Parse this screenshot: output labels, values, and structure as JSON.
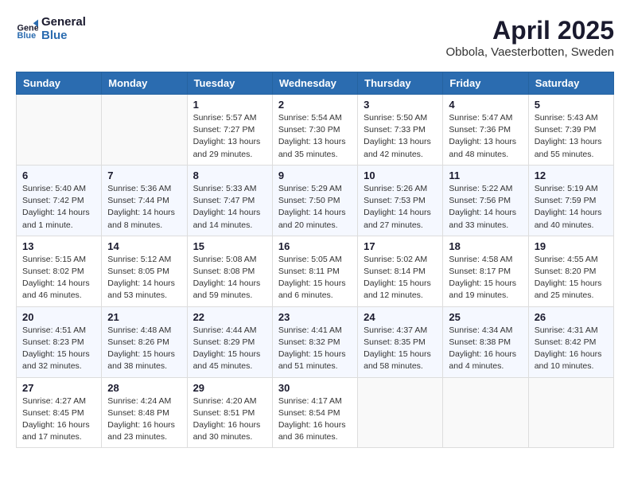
{
  "header": {
    "logo_line1": "General",
    "logo_line2": "Blue",
    "title": "April 2025",
    "subtitle": "Obbola, Vaesterbotten, Sweden"
  },
  "weekdays": [
    "Sunday",
    "Monday",
    "Tuesday",
    "Wednesday",
    "Thursday",
    "Friday",
    "Saturday"
  ],
  "weeks": [
    [
      {
        "day": "",
        "info": ""
      },
      {
        "day": "",
        "info": ""
      },
      {
        "day": "1",
        "info": "Sunrise: 5:57 AM\nSunset: 7:27 PM\nDaylight: 13 hours and 29 minutes."
      },
      {
        "day": "2",
        "info": "Sunrise: 5:54 AM\nSunset: 7:30 PM\nDaylight: 13 hours and 35 minutes."
      },
      {
        "day": "3",
        "info": "Sunrise: 5:50 AM\nSunset: 7:33 PM\nDaylight: 13 hours and 42 minutes."
      },
      {
        "day": "4",
        "info": "Sunrise: 5:47 AM\nSunset: 7:36 PM\nDaylight: 13 hours and 48 minutes."
      },
      {
        "day": "5",
        "info": "Sunrise: 5:43 AM\nSunset: 7:39 PM\nDaylight: 13 hours and 55 minutes."
      }
    ],
    [
      {
        "day": "6",
        "info": "Sunrise: 5:40 AM\nSunset: 7:42 PM\nDaylight: 14 hours and 1 minute."
      },
      {
        "day": "7",
        "info": "Sunrise: 5:36 AM\nSunset: 7:44 PM\nDaylight: 14 hours and 8 minutes."
      },
      {
        "day": "8",
        "info": "Sunrise: 5:33 AM\nSunset: 7:47 PM\nDaylight: 14 hours and 14 minutes."
      },
      {
        "day": "9",
        "info": "Sunrise: 5:29 AM\nSunset: 7:50 PM\nDaylight: 14 hours and 20 minutes."
      },
      {
        "day": "10",
        "info": "Sunrise: 5:26 AM\nSunset: 7:53 PM\nDaylight: 14 hours and 27 minutes."
      },
      {
        "day": "11",
        "info": "Sunrise: 5:22 AM\nSunset: 7:56 PM\nDaylight: 14 hours and 33 minutes."
      },
      {
        "day": "12",
        "info": "Sunrise: 5:19 AM\nSunset: 7:59 PM\nDaylight: 14 hours and 40 minutes."
      }
    ],
    [
      {
        "day": "13",
        "info": "Sunrise: 5:15 AM\nSunset: 8:02 PM\nDaylight: 14 hours and 46 minutes."
      },
      {
        "day": "14",
        "info": "Sunrise: 5:12 AM\nSunset: 8:05 PM\nDaylight: 14 hours and 53 minutes."
      },
      {
        "day": "15",
        "info": "Sunrise: 5:08 AM\nSunset: 8:08 PM\nDaylight: 14 hours and 59 minutes."
      },
      {
        "day": "16",
        "info": "Sunrise: 5:05 AM\nSunset: 8:11 PM\nDaylight: 15 hours and 6 minutes."
      },
      {
        "day": "17",
        "info": "Sunrise: 5:02 AM\nSunset: 8:14 PM\nDaylight: 15 hours and 12 minutes."
      },
      {
        "day": "18",
        "info": "Sunrise: 4:58 AM\nSunset: 8:17 PM\nDaylight: 15 hours and 19 minutes."
      },
      {
        "day": "19",
        "info": "Sunrise: 4:55 AM\nSunset: 8:20 PM\nDaylight: 15 hours and 25 minutes."
      }
    ],
    [
      {
        "day": "20",
        "info": "Sunrise: 4:51 AM\nSunset: 8:23 PM\nDaylight: 15 hours and 32 minutes."
      },
      {
        "day": "21",
        "info": "Sunrise: 4:48 AM\nSunset: 8:26 PM\nDaylight: 15 hours and 38 minutes."
      },
      {
        "day": "22",
        "info": "Sunrise: 4:44 AM\nSunset: 8:29 PM\nDaylight: 15 hours and 45 minutes."
      },
      {
        "day": "23",
        "info": "Sunrise: 4:41 AM\nSunset: 8:32 PM\nDaylight: 15 hours and 51 minutes."
      },
      {
        "day": "24",
        "info": "Sunrise: 4:37 AM\nSunset: 8:35 PM\nDaylight: 15 hours and 58 minutes."
      },
      {
        "day": "25",
        "info": "Sunrise: 4:34 AM\nSunset: 8:38 PM\nDaylight: 16 hours and 4 minutes."
      },
      {
        "day": "26",
        "info": "Sunrise: 4:31 AM\nSunset: 8:42 PM\nDaylight: 16 hours and 10 minutes."
      }
    ],
    [
      {
        "day": "27",
        "info": "Sunrise: 4:27 AM\nSunset: 8:45 PM\nDaylight: 16 hours and 17 minutes."
      },
      {
        "day": "28",
        "info": "Sunrise: 4:24 AM\nSunset: 8:48 PM\nDaylight: 16 hours and 23 minutes."
      },
      {
        "day": "29",
        "info": "Sunrise: 4:20 AM\nSunset: 8:51 PM\nDaylight: 16 hours and 30 minutes."
      },
      {
        "day": "30",
        "info": "Sunrise: 4:17 AM\nSunset: 8:54 PM\nDaylight: 16 hours and 36 minutes."
      },
      {
        "day": "",
        "info": ""
      },
      {
        "day": "",
        "info": ""
      },
      {
        "day": "",
        "info": ""
      }
    ]
  ]
}
